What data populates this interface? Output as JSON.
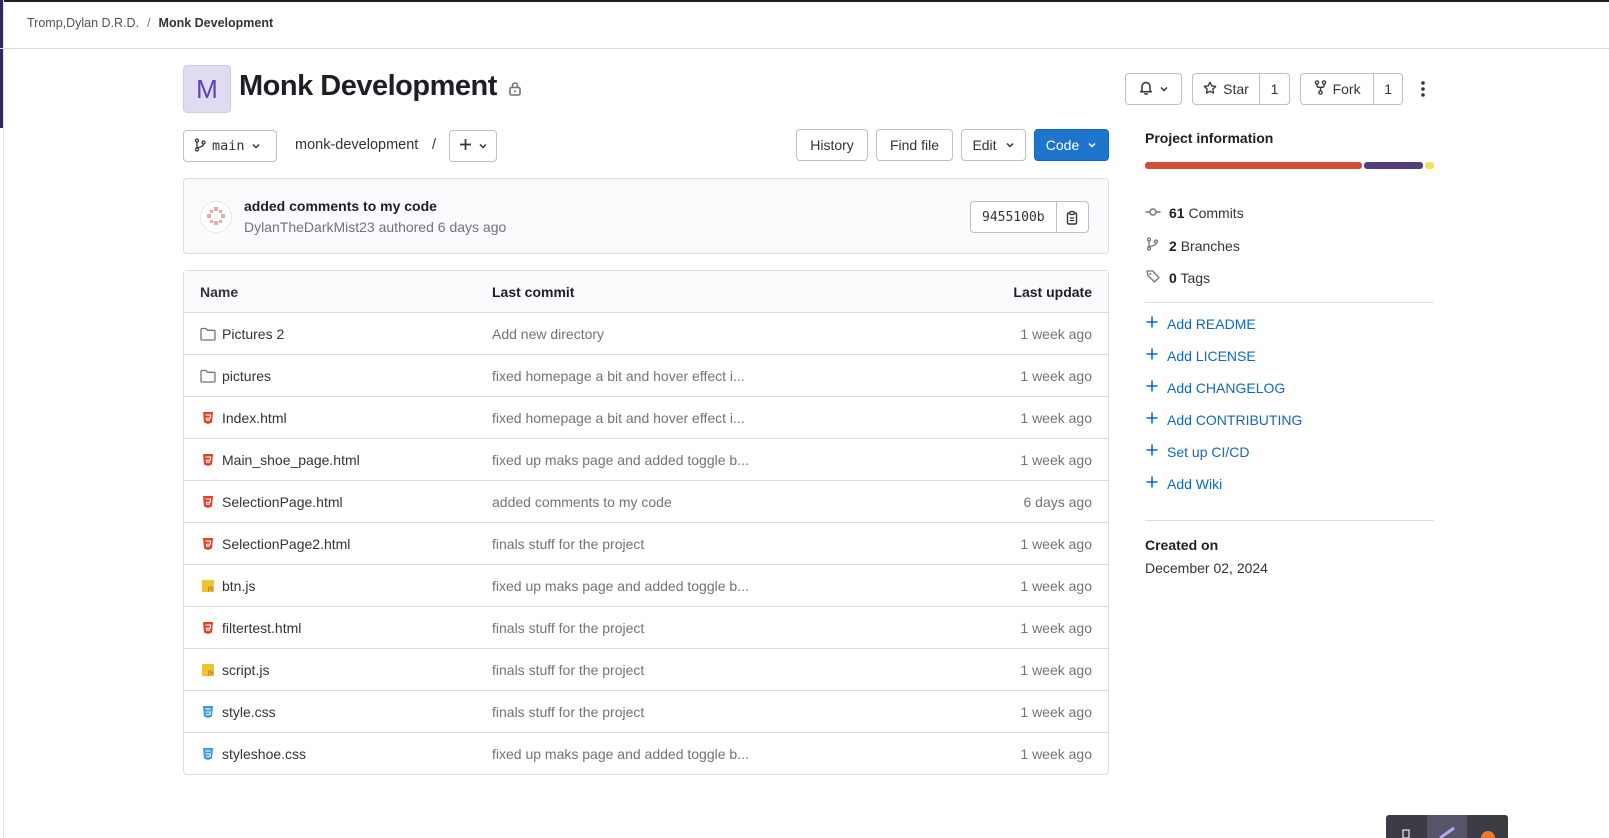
{
  "breadcrumb": {
    "group": "Tromp,Dylan D.R.D.",
    "separator": "/",
    "project": "Monk Development"
  },
  "project": {
    "avatar_letter": "M",
    "title": "Monk Development",
    "visibility_icon": "lock-icon"
  },
  "actions": {
    "notifications_icon": "bell-icon",
    "star_label": "Star",
    "star_count": "1",
    "fork_label": "Fork",
    "fork_count": "1",
    "more_icon": "kebab-icon"
  },
  "repo_bar": {
    "branch": "main",
    "path": "monk-development",
    "path_sep": "/",
    "add_icon": "plus-icon",
    "history": "History",
    "find_file": "Find file",
    "edit": "Edit",
    "code": "Code"
  },
  "last_commit": {
    "title": "added comments to my code",
    "author": "DylanTheDarkMist23",
    "meta_rest": "authored 6 days ago",
    "sha": "9455100b"
  },
  "table": {
    "headers": {
      "name": "Name",
      "commit": "Last commit",
      "update": "Last update"
    },
    "rows": [
      {
        "name": "Pictures 2",
        "type": "folder",
        "commit": "Add new directory",
        "date": "1 week ago"
      },
      {
        "name": "pictures",
        "type": "folder",
        "commit": "fixed homepage a bit and hover effect i...",
        "date": "1 week ago"
      },
      {
        "name": "Index.html",
        "type": "html",
        "commit": "fixed homepage a bit and hover effect i...",
        "date": "1 week ago"
      },
      {
        "name": "Main_shoe_page.html",
        "type": "html",
        "commit": "fixed up maks page and added toggle b...",
        "date": "1 week ago"
      },
      {
        "name": "SelectionPage.html",
        "type": "html",
        "commit": "added comments to my code",
        "date": "6 days ago"
      },
      {
        "name": "SelectionPage2.html",
        "type": "html",
        "commit": "finals stuff for the project",
        "date": "1 week ago"
      },
      {
        "name": "btn.js",
        "type": "js",
        "commit": "fixed up maks page and added toggle b...",
        "date": "1 week ago"
      },
      {
        "name": "filtertest.html",
        "type": "html",
        "commit": "finals stuff for the project",
        "date": "1 week ago"
      },
      {
        "name": "script.js",
        "type": "js",
        "commit": "finals stuff for the project",
        "date": "1 week ago"
      },
      {
        "name": "style.css",
        "type": "css",
        "commit": "finals stuff for the project",
        "date": "1 week ago"
      },
      {
        "name": "styleshoe.css",
        "type": "css",
        "commit": "fixed up maks page and added toggle b...",
        "date": "1 week ago"
      }
    ]
  },
  "sidebar": {
    "title": "Project information",
    "language_colors": [
      "#d34d36",
      "#563d7c",
      "#f1e05a"
    ],
    "language_shares": [
      0.76,
      0.21,
      0.03
    ],
    "commits": {
      "count": "61",
      "label": "Commits"
    },
    "branches": {
      "count": "2",
      "label": "Branches"
    },
    "tags": {
      "count": "0",
      "label": "Tags"
    },
    "links": [
      "Add README",
      "Add LICENSE",
      "Add CHANGELOG",
      "Add CONTRIBUTING",
      "Set up CI/CD",
      "Add Wiki"
    ],
    "created_label": "Created on",
    "created_value": "December 02, 2024"
  },
  "colors": {
    "primary": "#1f75cb",
    "link": "#1068bf",
    "html_icon": "#e24329",
    "js_icon": "#f1c232",
    "css_icon": "#3c9cd7"
  }
}
